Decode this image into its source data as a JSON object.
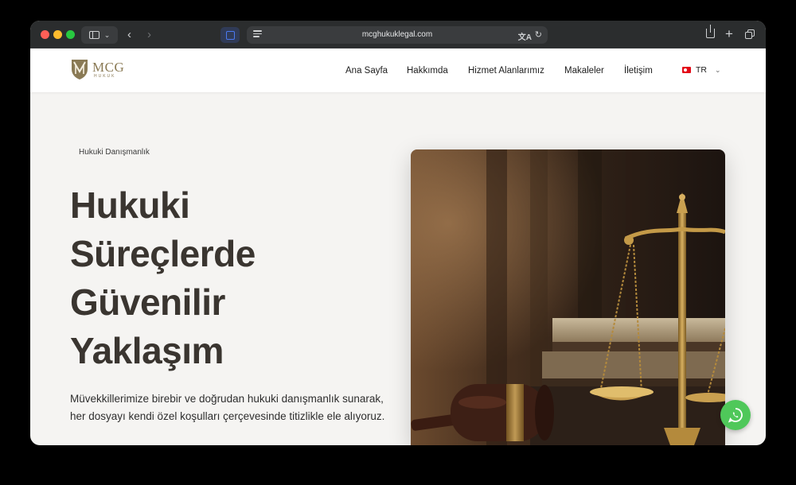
{
  "browser": {
    "url": "mcghukuklegal.com",
    "icons": [
      "sidebar-icon",
      "chevron-down-icon",
      "back-icon",
      "forward-icon",
      "extension-icon",
      "reader-icon",
      "translate-icon",
      "reload-icon",
      "share-icon",
      "plus-icon",
      "tabs-icon"
    ]
  },
  "header": {
    "logo_text": "MCG",
    "logo_subtext": "HUKUK",
    "nav": [
      {
        "label": "Ana Sayfa"
      },
      {
        "label": "Hakkımda"
      },
      {
        "label": "Hizmet Alanlarımız"
      },
      {
        "label": "Makaleler"
      },
      {
        "label": "İletişim"
      }
    ],
    "language": {
      "code": "TR"
    }
  },
  "hero": {
    "eyebrow": "Hukuki Danışmanlık",
    "title_lines": [
      "Hukuki",
      "Süreçlerde",
      "Güvenilir",
      "Yaklaşım"
    ],
    "description_lines": [
      "Müvekkillerimize birebir ve doğrudan hukuki danışmanlık sunarak,",
      "her dosyayı kendi özel koşulları çerçevesinde titizlikle ele alıyoruz."
    ]
  },
  "colors": {
    "brand_gold": "#8a7a55",
    "title": "#3a3530",
    "whatsapp": "#4fc85a",
    "page_bg": "#f5f4f2"
  }
}
